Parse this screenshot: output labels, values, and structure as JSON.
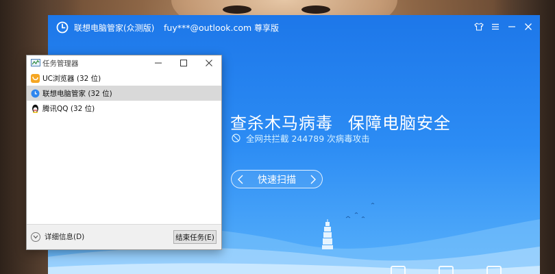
{
  "app": {
    "title": "联想电脑管家(众测版)",
    "account": "fuy***@outlook.com",
    "edition": "尊享版",
    "slogan_left": "查杀木马病毒",
    "slogan_right": "保障电脑安全",
    "intercept_text": "全网共拦截 244789 次病毒攻击",
    "scan_button": "快速扫描",
    "icons": [
      "shirt-icon",
      "menu-icon",
      "minimize-icon",
      "close-icon"
    ]
  },
  "task_manager": {
    "title": "任务管理器",
    "processes": [
      {
        "name": "UC浏览器 (32 位)",
        "icon": "uc-browser-icon",
        "selected": false
      },
      {
        "name": "联想电脑管家 (32 位)",
        "icon": "lenovo-manager-icon",
        "selected": true
      },
      {
        "name": "腾讯QQ (32 位)",
        "icon": "qq-penguin-icon",
        "selected": false
      }
    ],
    "details_label": "详细信息(D)",
    "end_task_label": "结束任务(E)"
  },
  "colors": {
    "app_blue_top": "#1d77e9",
    "app_blue_bottom": "#58b1fb",
    "selected_row": "#d9d9d9"
  }
}
